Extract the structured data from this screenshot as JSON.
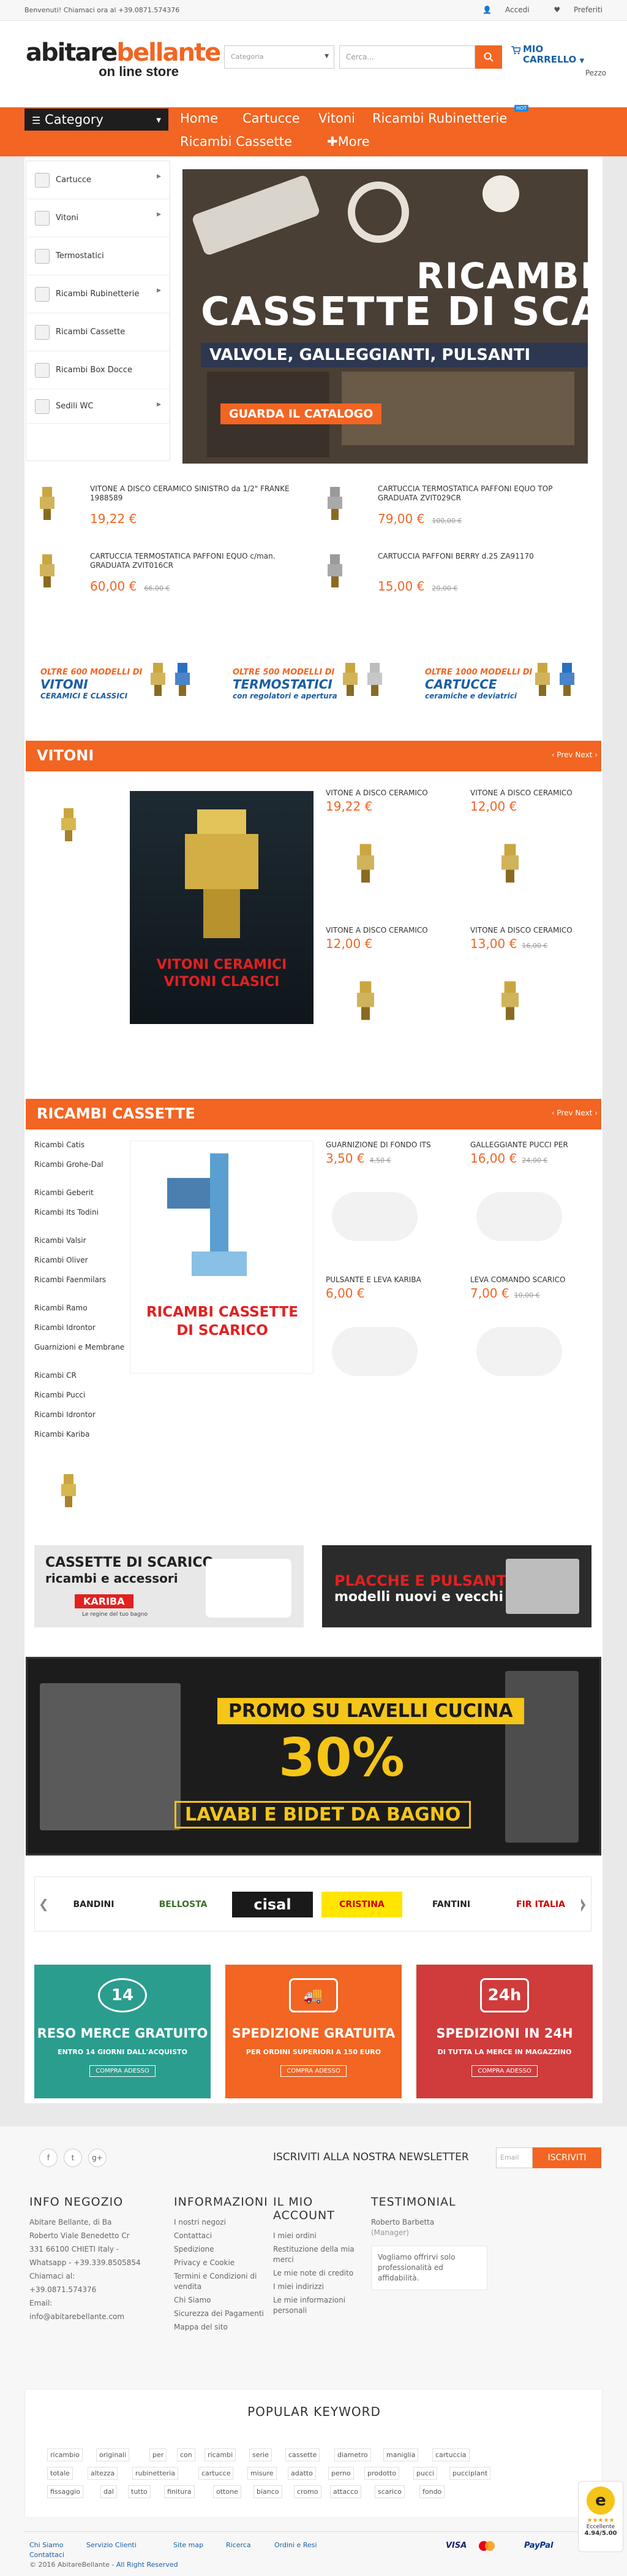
{
  "topbar": {
    "welcome": "Benvenuti! Chiamaci ora al +39.0871.574376",
    "login": "Accedi",
    "favorites": "Preferiti"
  },
  "logo": {
    "line1a": "abitare",
    "line1b": "bellante",
    "line2": "on line store"
  },
  "search": {
    "category": "Categoria",
    "placeholder": "Cerca..."
  },
  "cart": {
    "line1": "MIO",
    "line2": "CARRELLO",
    "count_label": "Pezzo"
  },
  "nav": {
    "category": "Category",
    "items": [
      "Home",
      "Cartucce",
      "Vitoni",
      "Ricambi Rubinetterie",
      "Ricambi Cassette",
      "More"
    ],
    "hot": "HOT"
  },
  "sidebar": [
    {
      "label": "Cartucce",
      "icon": "cartridge-icon"
    },
    {
      "label": "Vitoni",
      "icon": "valve-icon"
    },
    {
      "label": "Termostatici",
      "icon": "thermostat-icon"
    },
    {
      "label": "Ricambi Rubinetterie",
      "icon": "faucet-icon"
    },
    {
      "label": "Ricambi Cassette",
      "icon": "cistern-icon"
    },
    {
      "label": "Ricambi Box Docce",
      "icon": "shower-icon"
    },
    {
      "label": "Sedili WC",
      "icon": "toilet-icon"
    }
  ],
  "hero": {
    "title1": "RICAMBI",
    "title2": "CASSETTE DI SCARICO",
    "subtitle": "VALVOLE, GALLEGGIANTI, PULSANTI",
    "cta": "GUARDA IL CATALOGO"
  },
  "featured": [
    {
      "name": "VITONE A DISCO CERAMICO SINISTRO da 1/2\" FRANKE 1988589",
      "price": "19,22 €",
      "old": ""
    },
    {
      "name": "CARTUCCIA TERMOSTATICA PAFFONI EQUO TOP GRADUATA ZVIT029CR",
      "price": "79,00 €",
      "old": "100,00 €"
    },
    {
      "name": "CARTUCCIA TERMOSTATICA PAFFONI EQUO c/man. GRADUATA ZVIT016CR",
      "price": "60,00 €",
      "old": "66,00 €"
    },
    {
      "name": "CARTUCCIA PAFFONI BERRY d.25 ZA91170",
      "price": "15,00 €",
      "old": "20,00 €"
    }
  ],
  "promo_banners": [
    {
      "t1": "OLTRE 600 MODELLI DI",
      "t2": "VITONI",
      "t3": "CERAMICI E CLASSICI"
    },
    {
      "t1": "OLTRE 500 MODELLI DI",
      "t2": "TERMOSTATICI",
      "t3": "con regolatori e apertura"
    },
    {
      "t1": "OLTRE 1000 MODELLI DI",
      "t2": "CARTUCCE",
      "t3": "ceramiche e deviatrici"
    }
  ],
  "vitoni": {
    "title": "VITONI",
    "nav": "‹ Prev  Next ›",
    "banner1": "VITONI CERAMICI",
    "banner2": "VITONI CLASICI",
    "products": [
      {
        "name": "VITONE A DISCO CERAMICO",
        "price": "19,22 €",
        "old": ""
      },
      {
        "name": "VITONE A DISCO CERAMICO",
        "price": "12,00 €",
        "old": ""
      },
      {
        "name": "VITONE A DISCO CERAMICO",
        "price": "12,00 €",
        "old": ""
      },
      {
        "name": "VITONE A DISCO CERAMICO",
        "price": "13,00 €",
        "old": "16,00 €"
      }
    ]
  },
  "cassette": {
    "title": "RICAMBI CASSETTE",
    "nav": "‹ Prev  Next ›",
    "banner1": "RICAMBI CASSETTE",
    "banner2": "DI SCARICO",
    "links": [
      "Ricambi Catis",
      "Ricambi Grohe-Dal",
      "Ricambi Geberit",
      "Ricambi Its Todini",
      "Ricambi Valsir",
      "Ricambi Oliver",
      "Ricambi Faenmilars",
      "Ricambi Ramo",
      "Ricambi Idrontor",
      "Guarnizioni e Membrane",
      "Ricambi CR",
      "Ricambi Pucci",
      "Ricambi Idrontor",
      "Ricambi Kariba"
    ],
    "products": [
      {
        "name": "GUARNIZIONE DI FONDO ITS",
        "price": "3,50 €",
        "old": "4,50 €"
      },
      {
        "name": "GALLEGGIANTE PUCCI PER",
        "price": "16,00 €",
        "old": "24,00 €"
      },
      {
        "name": "PULSANTE E LEVA KARIBA",
        "price": "6,00 €",
        "old": ""
      },
      {
        "name": "LEVA COMANDO SCARICO",
        "price": "7,00 €",
        "old": "10,00 €"
      }
    ]
  },
  "wide_banners": [
    {
      "l1": "CASSETTE DI SCARICO",
      "l2": "ricambi e accessori",
      "brand": "KARIBA",
      "slogan": "Le regine del tuo bagno"
    },
    {
      "l1": "PLACCHE E PULSANTI",
      "l2": "modelli nuovi e vecchi"
    }
  ],
  "sale_banner": {
    "l1": "PROMO SU LAVELLI CUCINA",
    "l2": "30%",
    "l3": "LAVABI E BIDET DA BAGNO"
  },
  "brands": [
    "BANDINI",
    "BELLOSTA",
    "cisal",
    "CRISTINA",
    "FANTINI",
    "FIR ITALIA"
  ],
  "services": [
    {
      "title": "RESO MERCE GRATUITO",
      "sub": "ENTRO 14 GIORNI DALL'ACQUISTO",
      "btn": "COMPRA ADESSO",
      "badge": "14",
      "color": "#2a9d8f"
    },
    {
      "title": "SPEDIZIONE GRATUITA",
      "sub": "PER ORDINI SUPERIORI A 150 EURO",
      "btn": "COMPRA ADESSO",
      "badge": "truck",
      "color": "#f26522"
    },
    {
      "title": "SPEDIZIONI IN 24H",
      "sub": "DI TUTTA LA MERCE IN MAGAZZINO",
      "btn": "COMPRA ADESSO",
      "badge": "24h",
      "color": "#d03b3b"
    }
  ],
  "footer": {
    "newsletter": "ISCRIVITI ALLA NOSTRA NEWSLETTER",
    "newsletter_placeholder": "Email",
    "newsletter_btn": "ISCRIVITI",
    "info_title": "INFO NEGOZIO",
    "info": [
      "Abitare Bellante, di Ba",
      "Roberto Viale Benedetto Cr",
      "331 66100 CHIETI Italy -",
      "Whatsapp - +39.339.8505854",
      "Chiamaci al:",
      "+39.0871.574376",
      "Email:",
      "info@abitarebellante.com"
    ],
    "inform_title": "INFORMAZIONI",
    "inform": [
      "I nostri negozi",
      "Contattaci",
      "Spedizione",
      "Privacy e Cookie",
      "Termini e Condizioni di vendita",
      "Chi Siamo",
      "Sicurezza dei Pagamenti",
      "Mappa del sito"
    ],
    "account_title": "IL MIO ACCOUNT",
    "account": [
      "I miei ordini",
      "Restituzione della mia merci",
      "Le mie note di credito",
      "I miei indirizzi",
      "Le mie informazioni personali"
    ],
    "testi_title": "TESTIMONIAL",
    "testi_name": "Roberto Barbetta",
    "testi_role": "(Manager)",
    "testi_text": "Vogliamo offrirvi solo professionalità ed affidabilità.",
    "keyword_title": "POPULAR KEYWORD",
    "keywords1": [
      "ricambio",
      "originali",
      "per",
      "con",
      "ricambi",
      "serie",
      "cassette",
      "diametro",
      "maniglia",
      "cartuccia"
    ],
    "keywords2": [
      "totale",
      "altezza",
      "rubinetteria",
      "cartucce",
      "misure",
      "adatto",
      "perno",
      "prodotto",
      "pucci",
      "pucciplant"
    ],
    "keywords3": [
      "fissaggio",
      "dal",
      "tutto",
      "finitura",
      "ottone",
      "bianco",
      "cromo",
      "attacco",
      "scarico",
      "fondo"
    ],
    "bottom_links": [
      "Chi Siamo",
      "Servizio Clienti",
      "Site map",
      "Ricerca",
      "Ordini e Resi",
      "Contattaci"
    ],
    "copyright": "© 2016 AbitareBellante",
    "rights": "- All Right Reserved",
    "payments": [
      "VISA",
      "",
      "PayPal"
    ],
    "trusted": {
      "label": "Eccellente",
      "score": "4.94/5.00"
    }
  }
}
